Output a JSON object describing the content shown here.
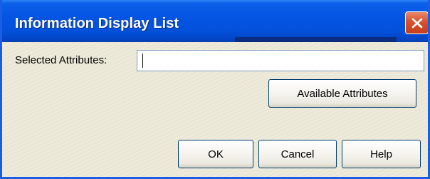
{
  "window": {
    "title": "Information Display List",
    "close_label": "Close"
  },
  "colors": {
    "titlebar": "#0554e3",
    "dialog_background": "#ece9d8",
    "close_button": "#d8502e"
  },
  "form": {
    "selected_attributes_label": "Selected Attributes:",
    "selected_attributes_value": "",
    "available_attributes_button": "Available Attributes"
  },
  "buttons": {
    "ok": "OK",
    "cancel": "Cancel",
    "help": "Help"
  }
}
